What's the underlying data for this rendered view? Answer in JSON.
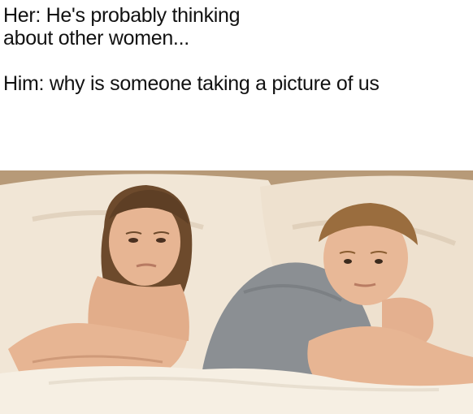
{
  "caption": {
    "her_line_1": "Her: He's probably thinking",
    "her_line_2": "about other women...",
    "him_line": "Him: why is someone taking a picture of us"
  },
  "photo": {
    "subject": "woman-and-man-in-bed",
    "colors": {
      "wall": "#d8c0a2",
      "headboard": "#b79a78",
      "pillow": "#f1e6d6",
      "sheet": "#f6efe3",
      "skin": "#e7b593",
      "woman_hair": "#6d4a2c",
      "man_hair": "#9a6d3e",
      "shirt": "#8b8f93"
    }
  }
}
